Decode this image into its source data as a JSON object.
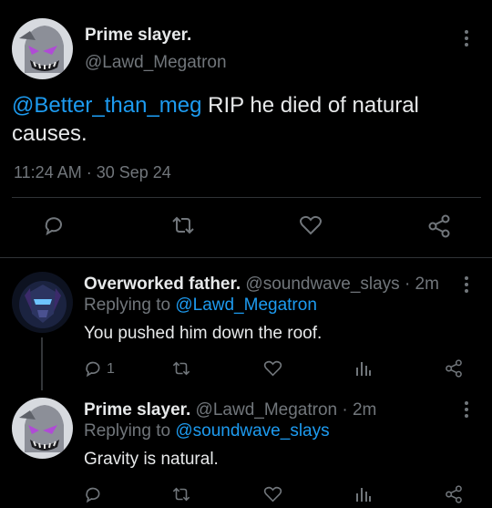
{
  "main_tweet": {
    "display_name": "Prime slayer.",
    "handle": "@Lawd_Megatron",
    "mention": "@Better_than_meg",
    "body_line1": " RIP he died of natural",
    "body_line2": "causes.",
    "time": "11:24 AM",
    "date_sep": "·",
    "date": "30 Sep 24"
  },
  "replies": [
    {
      "display_name": "Overworked father.",
      "handle": "@soundwave_slays",
      "age": "· 2m",
      "replying_prefix": "Replying to ",
      "replying_to": "@Lawd_Megatron",
      "body": "You pushed him down the roof.",
      "reply_count": "1"
    },
    {
      "display_name": "Prime slayer.",
      "handle": "@Lawd_Megatron",
      "age": "· 2m",
      "replying_prefix": "Replying to ",
      "replying_to": "@soundwave_slays",
      "body": "Gravity is natural."
    }
  ],
  "icons": [
    "reply-icon",
    "retweet-icon",
    "like-icon",
    "share-icon",
    "views-icon",
    "more-icon"
  ],
  "colors": {
    "background": "#000000",
    "text": "#e7e9ea",
    "muted": "#71767b",
    "link": "#1d9bf0",
    "divider": "#2f3336"
  }
}
